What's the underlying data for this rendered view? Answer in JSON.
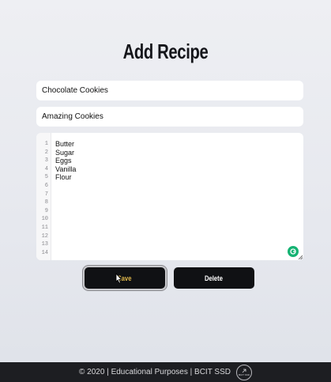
{
  "page": {
    "title": "Add Recipe"
  },
  "form": {
    "recipe_title": "Chocolate Cookies",
    "recipe_description": "Amazing Cookies",
    "ingredients_lines": [
      "Butter",
      "Sugar",
      "Eggs",
      "Vanilla",
      "Flour",
      "",
      "",
      "",
      "",
      "",
      "",
      "",
      "",
      ""
    ],
    "line_numbers": [
      "1",
      "2",
      "3",
      "4",
      "5",
      "6",
      "7",
      "8",
      "9",
      "10",
      "11",
      "12",
      "13",
      "14"
    ]
  },
  "buttons": {
    "save_label": "Save",
    "delete_label": "Delete"
  },
  "footer": {
    "text": "© 2020 | Educational Purposes | BCIT SSD",
    "logo_text": "BCIT SSD"
  },
  "colors": {
    "accent_save_text": "#e0b84a",
    "button_bg": "#101114",
    "footer_bg": "#1d1e22",
    "grammarly_green": "#15b373"
  },
  "icons": {
    "grammarly": "grammarly-icon",
    "cursor": "mouse-pointer-icon",
    "resize": "resize-handle-icon",
    "logo": "footer-logo-icon"
  }
}
